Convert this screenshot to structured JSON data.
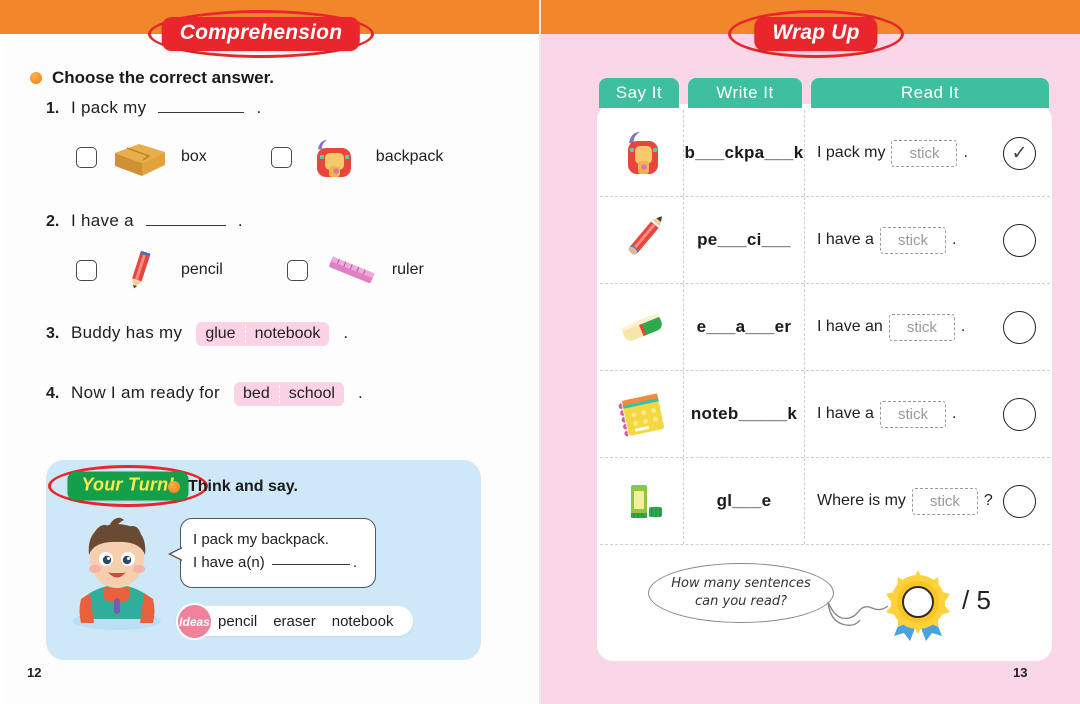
{
  "left_page": {
    "section_badge": "Comprehension",
    "page_number": "12",
    "instruction": "Choose the correct answer.",
    "questions": [
      {
        "num": "1.",
        "text_before": "I pack my",
        "text_after": ".",
        "choices": [
          {
            "label": "box",
            "icon": "box-icon"
          },
          {
            "label": "backpack",
            "icon": "backpack-icon"
          }
        ]
      },
      {
        "num": "2.",
        "text_before": "I have a",
        "text_after": ".",
        "choices": [
          {
            "label": "pencil",
            "icon": "pencil-icon"
          },
          {
            "label": "ruler",
            "icon": "ruler-icon"
          }
        ]
      },
      {
        "num": "3.",
        "text_before": "Buddy has my",
        "text_after": ".",
        "options": [
          "glue",
          "notebook"
        ]
      },
      {
        "num": "4.",
        "text_before": "Now I am ready for",
        "text_after": ".",
        "options": [
          "bed",
          "school"
        ]
      }
    ],
    "your_turn": {
      "badge": "Your Turn!",
      "heading": "Think and say.",
      "bubble_line1": "I pack my backpack.",
      "bubble_line2_before": "I have a(n)",
      "bubble_line2_after": ".",
      "ideas_label": "Ideas",
      "ideas": [
        "pencil",
        "eraser",
        "notebook"
      ]
    }
  },
  "right_page": {
    "section_badge": "Wrap Up",
    "page_number": "13",
    "table": {
      "headers": [
        "Say It",
        "Write It",
        "Read It"
      ],
      "rows": [
        {
          "icon": "backpack-icon",
          "write": "b___ckpa___k",
          "read_before": "I pack my",
          "read_box": "stick",
          "read_after": ".",
          "checked": true
        },
        {
          "icon": "pencil-icon",
          "write": "pe___ci___",
          "read_before": "I have a",
          "read_box": "stick",
          "read_after": ".",
          "checked": false
        },
        {
          "icon": "eraser-icon",
          "write": "e___a___er",
          "read_before": "I have an",
          "read_box": "stick",
          "read_after": ".",
          "checked": false
        },
        {
          "icon": "notebook-icon",
          "write": "noteb_____k",
          "read_before": "I have a",
          "read_box": "stick",
          "read_after": ".",
          "checked": false
        },
        {
          "icon": "glue-icon",
          "write": "gl___e",
          "read_before": "Where is my",
          "read_box": "stick",
          "read_after": "?",
          "checked": false
        }
      ]
    },
    "footer": {
      "question_line1": "How many sentences",
      "question_line2": "can you read?",
      "score_total": "/ 5",
      "medal_icon": "medal-icon"
    }
  },
  "colors": {
    "banner_orange": "#f2862b",
    "badge_red": "#e8262b",
    "badge_green": "#14a04a",
    "header_teal": "#3dbfa0",
    "right_page_pink": "#fad7e6",
    "panel_blue": "#cfe8f7",
    "word_pick_pink": "#fbd3e4",
    "ideas_pink": "#f2829c"
  }
}
